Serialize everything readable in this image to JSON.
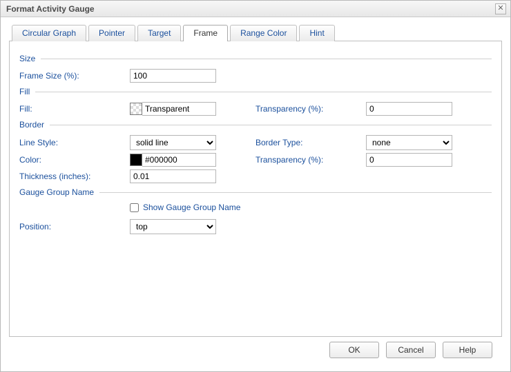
{
  "dialog": {
    "title": "Format Activity Gauge"
  },
  "tabs": {
    "items": [
      "Circular Graph",
      "Pointer",
      "Target",
      "Frame",
      "Range Color",
      "Hint"
    ],
    "active_index": 3
  },
  "size": {
    "heading": "Size",
    "frame_size_label": "Frame Size (%):",
    "frame_size_value": "100"
  },
  "fill": {
    "heading": "Fill",
    "fill_label": "Fill:",
    "fill_value": "Transparent",
    "transparency_label": "Transparency (%):",
    "transparency_value": "0"
  },
  "border": {
    "heading": "Border",
    "line_style_label": "Line Style:",
    "line_style_value": "solid line",
    "border_type_label": "Border Type:",
    "border_type_value": "none",
    "color_label": "Color:",
    "color_value": "#000000",
    "color_swatch": "#000000",
    "transparency_label": "Transparency (%):",
    "transparency_value": "0",
    "thickness_label": "Thickness (inches):",
    "thickness_value": "0.01"
  },
  "gauge_group": {
    "heading": "Gauge Group Name",
    "show_label": "Show Gauge Group Name",
    "show_checked": false,
    "position_label": "Position:",
    "position_value": "top"
  },
  "buttons": {
    "ok": "OK",
    "cancel": "Cancel",
    "help": "Help"
  }
}
